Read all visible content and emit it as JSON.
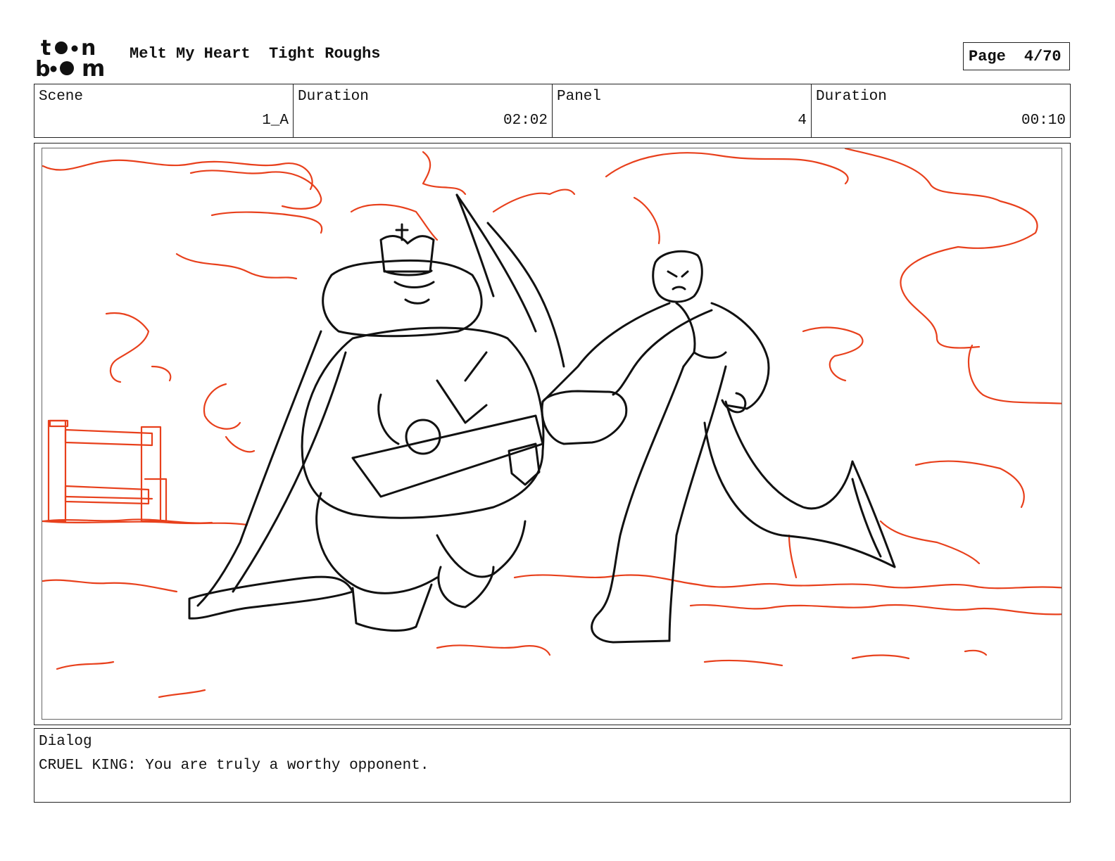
{
  "header": {
    "logo": {
      "icon": "toon-boom-logo",
      "text_top": "toon",
      "text_bottom": "boom"
    },
    "project_title": "Melt My Heart",
    "section_title": "Tight Roughs",
    "page_label": "Page",
    "page_number": "4/70"
  },
  "info": {
    "scene_label": "Scene",
    "scene_value": "1_A",
    "scene_duration_label": "Duration",
    "scene_duration_value": "02:02",
    "panel_label": "Panel",
    "panel_value": "4",
    "panel_duration_label": "Duration",
    "panel_duration_value": "00:10"
  },
  "panel": {
    "drawing": "storyboard-sketch",
    "line_color": "#111111",
    "background_sketch_color": "#e8401c"
  },
  "dialog": {
    "label": "Dialog",
    "text": "CRUEL KING: You are truly a worthy opponent."
  }
}
